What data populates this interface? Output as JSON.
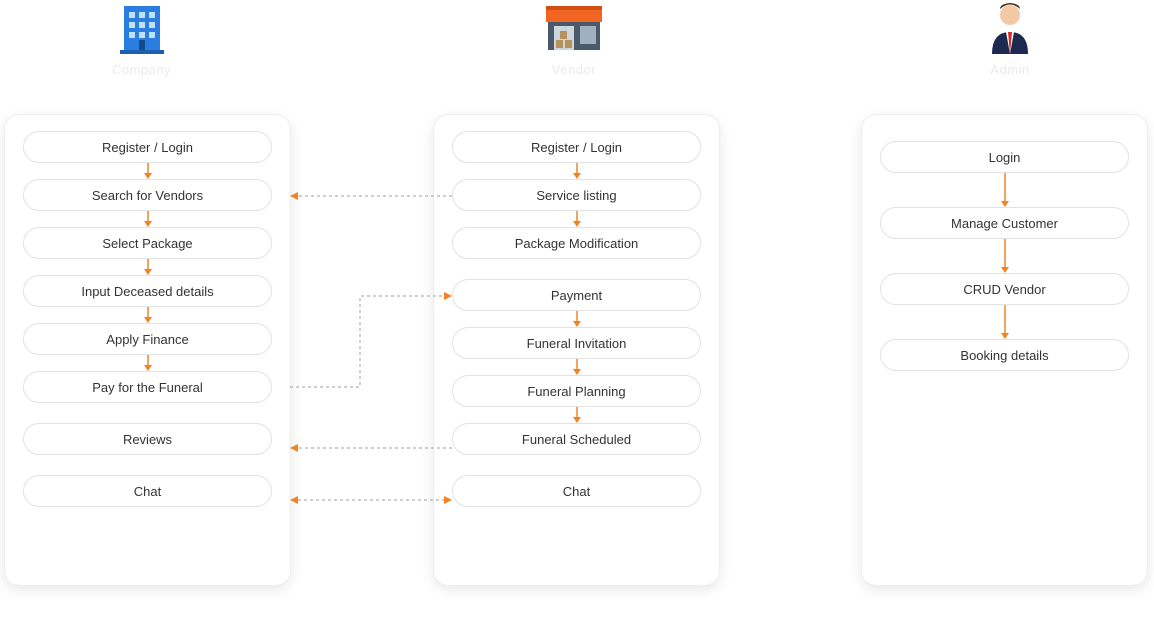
{
  "entities": {
    "company": {
      "label": "Company"
    },
    "vendor": {
      "label": "Vendor"
    },
    "admin": {
      "label": "Admin"
    }
  },
  "columns": {
    "company": {
      "steps": [
        "Register / Login",
        "Search for Vendors",
        "Select Package",
        "Input Deceased details",
        "Apply Finance",
        "Pay for the Funeral",
        "Reviews",
        "Chat"
      ]
    },
    "vendor": {
      "steps": [
        "Register / Login",
        "Service listing",
        "Package Modification",
        "Payment",
        "Funeral Invitation",
        "Funeral Planning",
        "Funeral Scheduled",
        "Chat"
      ]
    },
    "admin": {
      "steps": [
        "Login",
        "Manage Customer",
        "CRUD Vendor",
        "Booking details"
      ]
    }
  },
  "colors": {
    "accent": "#f58220",
    "building": "#2a7de1",
    "vendorRoof": "#f26522",
    "adminSuit": "#1b2a4e",
    "adminTie": "#d62c2c"
  }
}
